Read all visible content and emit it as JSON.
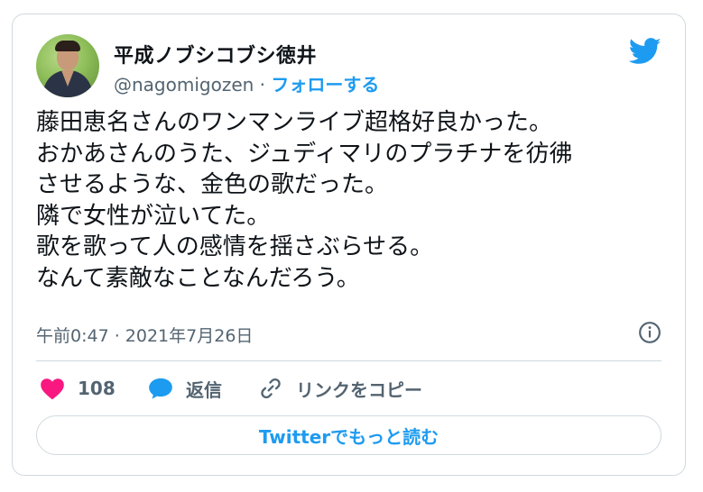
{
  "user": {
    "display_name": "平成ノブシコブシ徳井",
    "handle": "@nagomigozen",
    "separator": " · ",
    "follow_label": "フォローする"
  },
  "tweet": {
    "lines": [
      "藤田恵名さんのワンマンライブ超格好良かった。",
      "おかあさんのうた、ジュディマリのプラチナを彷彿",
      "させるような、金色の歌だった。",
      "隣で女性が泣いてた。",
      "歌を歌って人の感情を揺さぶらせる。",
      "なんて素敵なことなんだろう。"
    ],
    "timestamp": "午前0:47 · 2021年7月26日"
  },
  "actions": {
    "like_count": "108",
    "reply_label": "返信",
    "copy_link_label": "リンクをコピー"
  },
  "more_button_label": "Twitterでもっと読む",
  "icons": {
    "brand": "twitter-bird-icon",
    "like": "heart-icon",
    "reply": "speech-bubble-icon",
    "copy": "link-icon",
    "info": "info-icon"
  },
  "colors": {
    "accent": "#1d9bf0",
    "like": "#f91880",
    "text": "#0f1419",
    "secondary": "#536471",
    "border": "#cfd9de"
  }
}
